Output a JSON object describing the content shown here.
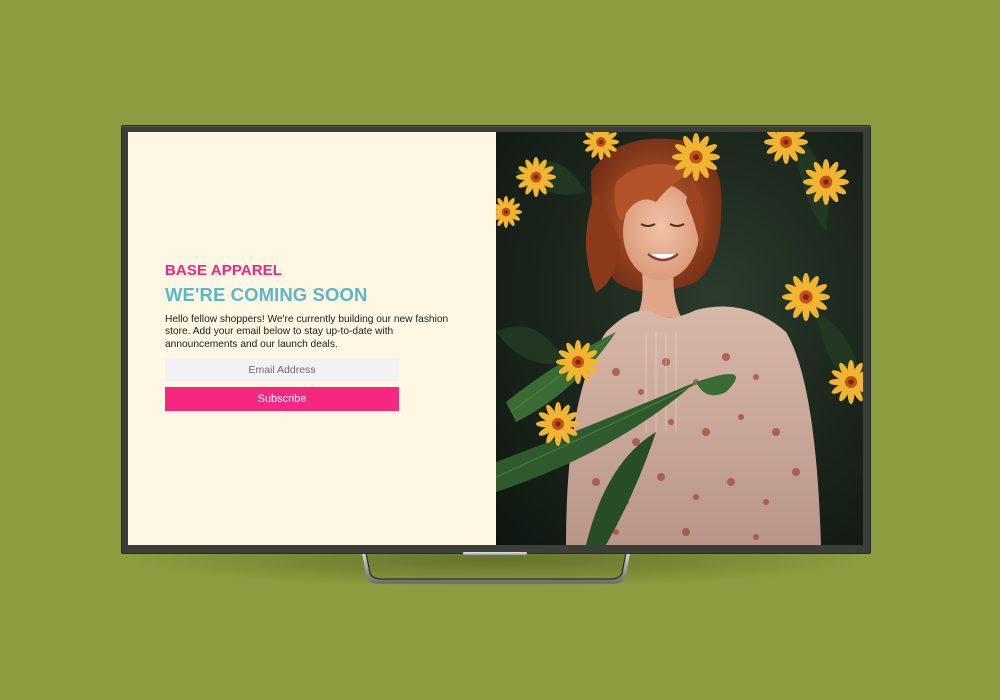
{
  "page": {
    "brand": "BASE APPAREL",
    "headline": "WE'RE COMING SOON",
    "description": "Hello fellow shoppers! We're currently building our new fashion store. Add your email below to stay up-to-date with announcements and our launch deals.",
    "email_placeholder": "Email Address",
    "subscribe_label": "Subscribe"
  },
  "colors": {
    "background": "#8c9c3e",
    "brand_pink": "#f0267f",
    "headline_teal": "#5bb7c6",
    "panel_cream": "#fef7e4",
    "input_bg": "#f2f2f4",
    "button_pink": "#f5277f"
  },
  "hero_image": {
    "subject": "smiling woman with red hair in floral blouse among yellow daisies and dark green leaves"
  }
}
